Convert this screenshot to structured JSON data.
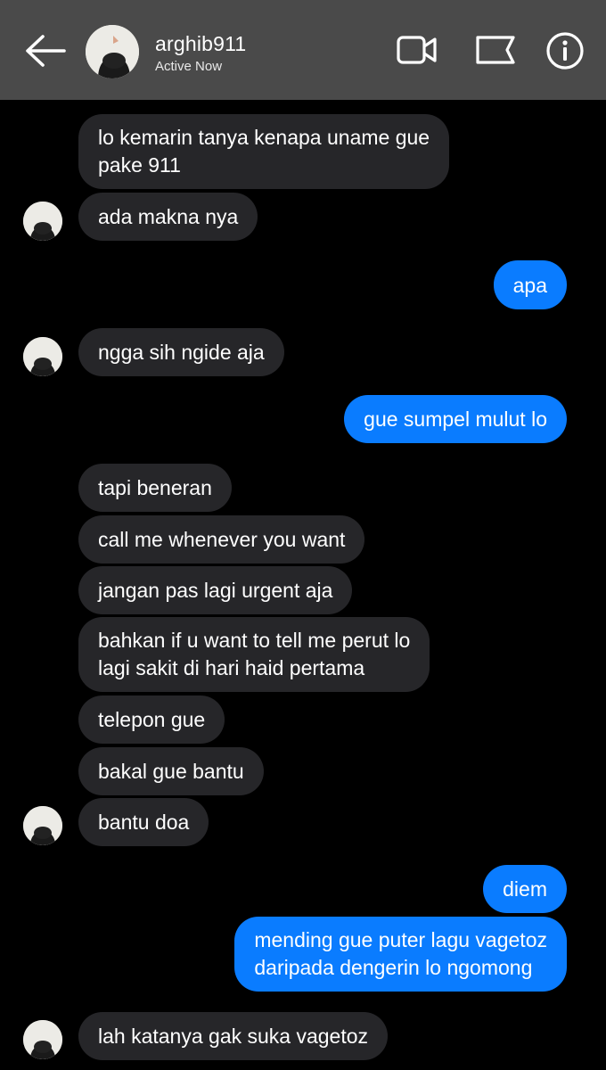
{
  "header": {
    "username": "arghib911",
    "status": "Active Now",
    "icons": [
      "arrow-left-icon",
      "video-camera-icon",
      "flag-icon",
      "info-icon"
    ]
  },
  "colors": {
    "header_bg": "#4a4a4a",
    "incoming_bubble": "#262629",
    "outgoing_bubble": "#0a7cff",
    "background": "#000000"
  },
  "messages": [
    {
      "from": "them",
      "text": "lo kemarin tanya kenapa uname gue\npake 911"
    },
    {
      "from": "them",
      "text": "ada makna nya"
    },
    {
      "from": "me",
      "text": "apa"
    },
    {
      "from": "them",
      "text": "ngga sih ngide aja"
    },
    {
      "from": "me",
      "text": "gue sumpel mulut lo"
    },
    {
      "from": "them",
      "text": "tapi beneran"
    },
    {
      "from": "them",
      "text": "call me whenever you want"
    },
    {
      "from": "them",
      "text": "jangan pas lagi urgent aja"
    },
    {
      "from": "them",
      "text": "bahkan if u want to tell me perut lo\nlagi sakit di hari haid pertama"
    },
    {
      "from": "them",
      "text": "telepon gue"
    },
    {
      "from": "them",
      "text": "bakal gue bantu"
    },
    {
      "from": "them",
      "text": "bantu doa"
    },
    {
      "from": "me",
      "text": "diem"
    },
    {
      "from": "me",
      "text": "mending gue puter lagu vagetoz\ndaripada dengerin lo ngomong"
    },
    {
      "from": "them",
      "text": "lah katanya gak suka vagetoz"
    }
  ]
}
